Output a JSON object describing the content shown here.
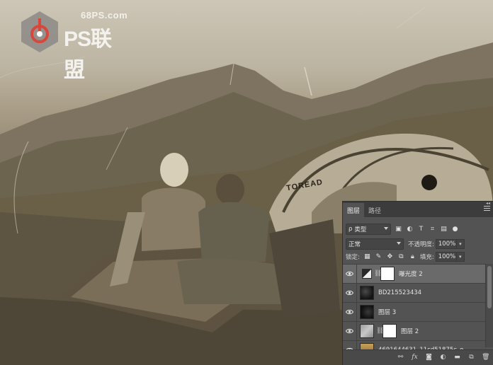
{
  "watermark": {
    "url": "68PS.com",
    "brand": "PS联盟"
  },
  "scene": {
    "tent_brand": "TOREAD"
  },
  "panel": {
    "tabs": [
      {
        "label": "图层",
        "active": true
      },
      {
        "label": "路径",
        "active": false
      }
    ],
    "filter": {
      "label": "类型",
      "search_glyph": "ρ"
    },
    "blend_mode": "正常",
    "opacity_label": "不透明度:",
    "opacity_value": "100%",
    "lock_label": "锁定:",
    "fill_label": "填充:",
    "fill_value": "100%",
    "layers": [
      {
        "name": "曝光度 2",
        "type": "adjustment",
        "selected": true,
        "has_mask": true
      },
      {
        "name": "BD215523434",
        "type": "dark-texture",
        "selected": false,
        "has_mask": false
      },
      {
        "name": "图层 3",
        "type": "dark-texture",
        "selected": false,
        "has_mask": false
      },
      {
        "name": "图层 2",
        "type": "gray-texture",
        "selected": false,
        "has_mask": true
      },
      {
        "name": "4691644631_11cd51875c_o",
        "type": "photo",
        "selected": false,
        "has_mask": false
      }
    ],
    "bottom_icons": [
      "link-icon",
      "fx-icon",
      "mask-icon",
      "adjustment-icon",
      "folder-icon",
      "new-layer-icon",
      "trash-icon"
    ]
  },
  "colors": {
    "panel_bg": "#535353",
    "selected_row": "#6a6a6a",
    "tab_bar": "#3c3c3c"
  }
}
